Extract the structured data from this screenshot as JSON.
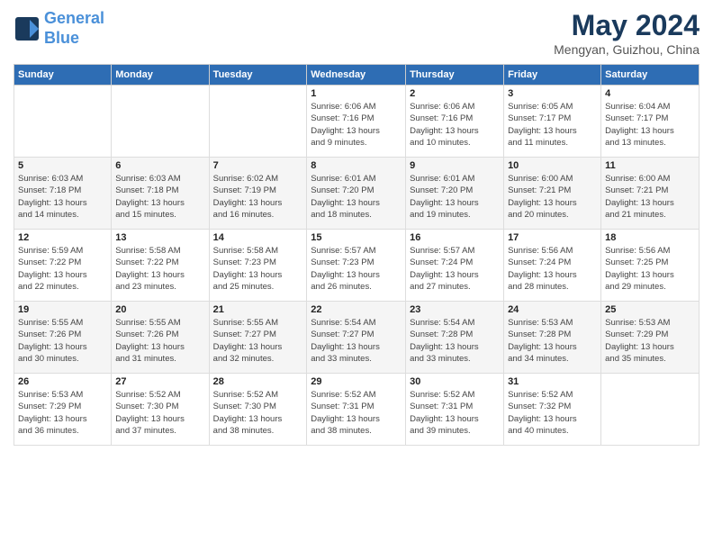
{
  "header": {
    "logo_line1": "General",
    "logo_line2": "Blue",
    "month": "May 2024",
    "location": "Mengyan, Guizhou, China"
  },
  "weekdays": [
    "Sunday",
    "Monday",
    "Tuesday",
    "Wednesday",
    "Thursday",
    "Friday",
    "Saturday"
  ],
  "rows": [
    [
      {
        "day": "",
        "info": ""
      },
      {
        "day": "",
        "info": ""
      },
      {
        "day": "",
        "info": ""
      },
      {
        "day": "1",
        "info": "Sunrise: 6:06 AM\nSunset: 7:16 PM\nDaylight: 13 hours\nand 9 minutes."
      },
      {
        "day": "2",
        "info": "Sunrise: 6:06 AM\nSunset: 7:16 PM\nDaylight: 13 hours\nand 10 minutes."
      },
      {
        "day": "3",
        "info": "Sunrise: 6:05 AM\nSunset: 7:17 PM\nDaylight: 13 hours\nand 11 minutes."
      },
      {
        "day": "4",
        "info": "Sunrise: 6:04 AM\nSunset: 7:17 PM\nDaylight: 13 hours\nand 13 minutes."
      }
    ],
    [
      {
        "day": "5",
        "info": "Sunrise: 6:03 AM\nSunset: 7:18 PM\nDaylight: 13 hours\nand 14 minutes."
      },
      {
        "day": "6",
        "info": "Sunrise: 6:03 AM\nSunset: 7:18 PM\nDaylight: 13 hours\nand 15 minutes."
      },
      {
        "day": "7",
        "info": "Sunrise: 6:02 AM\nSunset: 7:19 PM\nDaylight: 13 hours\nand 16 minutes."
      },
      {
        "day": "8",
        "info": "Sunrise: 6:01 AM\nSunset: 7:20 PM\nDaylight: 13 hours\nand 18 minutes."
      },
      {
        "day": "9",
        "info": "Sunrise: 6:01 AM\nSunset: 7:20 PM\nDaylight: 13 hours\nand 19 minutes."
      },
      {
        "day": "10",
        "info": "Sunrise: 6:00 AM\nSunset: 7:21 PM\nDaylight: 13 hours\nand 20 minutes."
      },
      {
        "day": "11",
        "info": "Sunrise: 6:00 AM\nSunset: 7:21 PM\nDaylight: 13 hours\nand 21 minutes."
      }
    ],
    [
      {
        "day": "12",
        "info": "Sunrise: 5:59 AM\nSunset: 7:22 PM\nDaylight: 13 hours\nand 22 minutes."
      },
      {
        "day": "13",
        "info": "Sunrise: 5:58 AM\nSunset: 7:22 PM\nDaylight: 13 hours\nand 23 minutes."
      },
      {
        "day": "14",
        "info": "Sunrise: 5:58 AM\nSunset: 7:23 PM\nDaylight: 13 hours\nand 25 minutes."
      },
      {
        "day": "15",
        "info": "Sunrise: 5:57 AM\nSunset: 7:23 PM\nDaylight: 13 hours\nand 26 minutes."
      },
      {
        "day": "16",
        "info": "Sunrise: 5:57 AM\nSunset: 7:24 PM\nDaylight: 13 hours\nand 27 minutes."
      },
      {
        "day": "17",
        "info": "Sunrise: 5:56 AM\nSunset: 7:24 PM\nDaylight: 13 hours\nand 28 minutes."
      },
      {
        "day": "18",
        "info": "Sunrise: 5:56 AM\nSunset: 7:25 PM\nDaylight: 13 hours\nand 29 minutes."
      }
    ],
    [
      {
        "day": "19",
        "info": "Sunrise: 5:55 AM\nSunset: 7:26 PM\nDaylight: 13 hours\nand 30 minutes."
      },
      {
        "day": "20",
        "info": "Sunrise: 5:55 AM\nSunset: 7:26 PM\nDaylight: 13 hours\nand 31 minutes."
      },
      {
        "day": "21",
        "info": "Sunrise: 5:55 AM\nSunset: 7:27 PM\nDaylight: 13 hours\nand 32 minutes."
      },
      {
        "day": "22",
        "info": "Sunrise: 5:54 AM\nSunset: 7:27 PM\nDaylight: 13 hours\nand 33 minutes."
      },
      {
        "day": "23",
        "info": "Sunrise: 5:54 AM\nSunset: 7:28 PM\nDaylight: 13 hours\nand 33 minutes."
      },
      {
        "day": "24",
        "info": "Sunrise: 5:53 AM\nSunset: 7:28 PM\nDaylight: 13 hours\nand 34 minutes."
      },
      {
        "day": "25",
        "info": "Sunrise: 5:53 AM\nSunset: 7:29 PM\nDaylight: 13 hours\nand 35 minutes."
      }
    ],
    [
      {
        "day": "26",
        "info": "Sunrise: 5:53 AM\nSunset: 7:29 PM\nDaylight: 13 hours\nand 36 minutes."
      },
      {
        "day": "27",
        "info": "Sunrise: 5:52 AM\nSunset: 7:30 PM\nDaylight: 13 hours\nand 37 minutes."
      },
      {
        "day": "28",
        "info": "Sunrise: 5:52 AM\nSunset: 7:30 PM\nDaylight: 13 hours\nand 38 minutes."
      },
      {
        "day": "29",
        "info": "Sunrise: 5:52 AM\nSunset: 7:31 PM\nDaylight: 13 hours\nand 38 minutes."
      },
      {
        "day": "30",
        "info": "Sunrise: 5:52 AM\nSunset: 7:31 PM\nDaylight: 13 hours\nand 39 minutes."
      },
      {
        "day": "31",
        "info": "Sunrise: 5:52 AM\nSunset: 7:32 PM\nDaylight: 13 hours\nand 40 minutes."
      },
      {
        "day": "",
        "info": ""
      }
    ]
  ]
}
